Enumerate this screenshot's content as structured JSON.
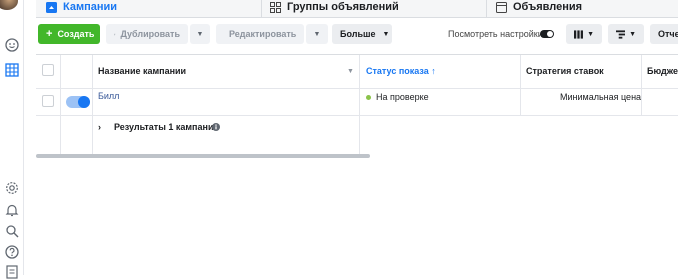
{
  "tabs": [
    {
      "label": "Кампании",
      "icon": "folder-icon"
    },
    {
      "label": "Группы объявлений",
      "icon": "grid-icon"
    },
    {
      "label": "Объявления",
      "icon": "ad-icon"
    }
  ],
  "toolbar": {
    "create_label": "Создать",
    "duplicate_label": "Дублировать",
    "edit_label": "Редактировать",
    "more_label": "Больше",
    "view_settings_label": "Посмотреть настройки",
    "reports_label": "Отче"
  },
  "table": {
    "columns": [
      "Название кампании",
      "Статус показа ↑",
      "Стратегия ставок",
      "Бюджет"
    ],
    "rows": [
      {
        "name": "Билл",
        "status": "На проверке",
        "bid_strategy": "Минимальная цена",
        "budget": ""
      }
    ],
    "results_label": "Результаты 1 кампании"
  },
  "colors": {
    "accent": "#1877f2",
    "create": "#42b72a",
    "status": "#8bc34a"
  }
}
